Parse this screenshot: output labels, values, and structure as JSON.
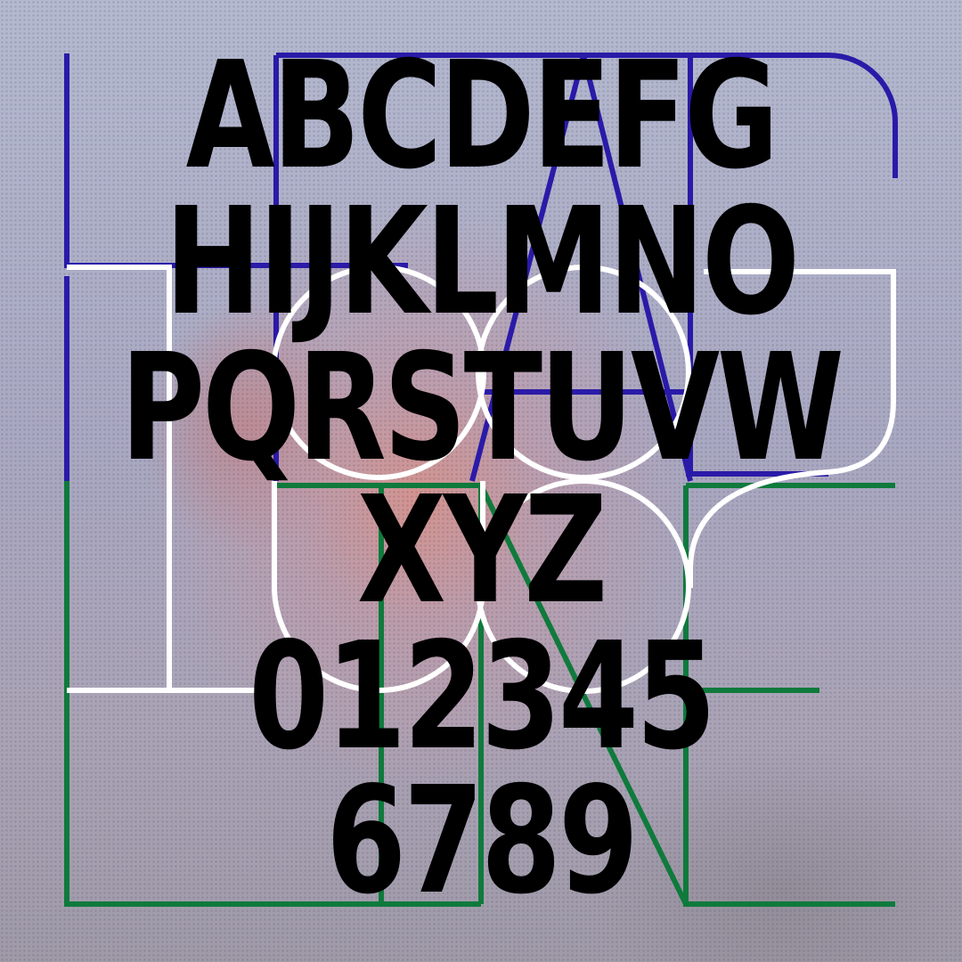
{
  "rows": [
    "ABCDEFG",
    "HIJKLMNO",
    "PQRSTUVW",
    "XYZ",
    "012345",
    "6789"
  ],
  "colors": {
    "blue": "#2a1aa8",
    "green": "#0f7a3c",
    "white": "#ffffff",
    "text": "#000000"
  }
}
